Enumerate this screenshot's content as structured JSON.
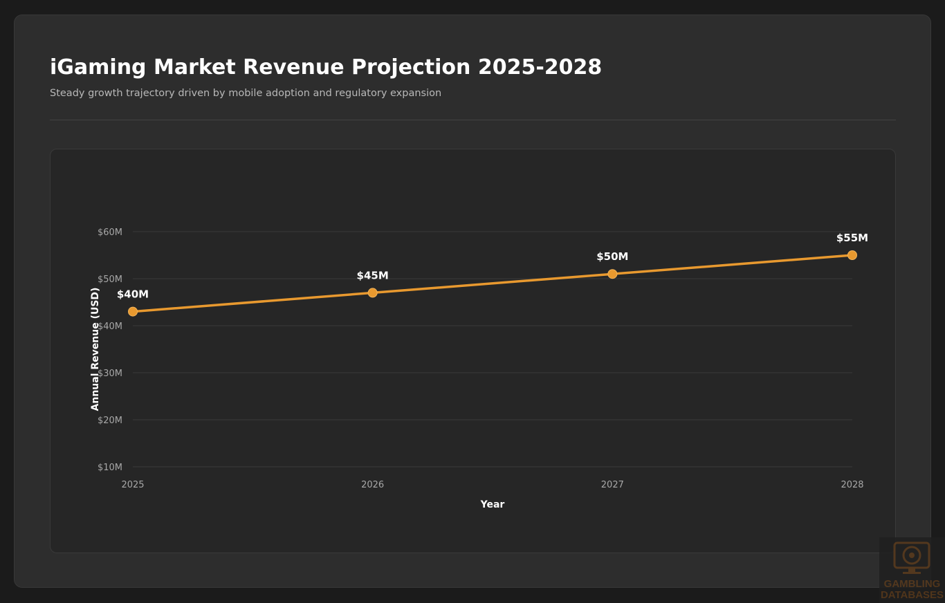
{
  "header": {
    "title": "iGaming Market Revenue Projection 2025-2028",
    "subtitle": "Steady growth trajectory driven by mobile adoption and regulatory expansion"
  },
  "colors": {
    "line": "#e8992f",
    "grid": "#3a3a3a",
    "tick_text": "#a8a8a8",
    "label_text": "#ffffff"
  },
  "chart_data": {
    "type": "line",
    "title": "",
    "xlabel": "Year",
    "ylabel": "Annual Revenue (USD)",
    "categories": [
      "2025",
      "2026",
      "2027",
      "2028"
    ],
    "values": [
      43,
      47,
      51,
      55
    ],
    "data_labels": [
      "$40M",
      "$45M",
      "$50M",
      "$55M"
    ],
    "yticks": [
      10,
      20,
      30,
      40,
      50,
      60
    ],
    "ytick_labels": [
      "$10M",
      "$20M",
      "$30M",
      "$40M",
      "$50M",
      "$60M"
    ],
    "ylim": [
      10,
      60
    ],
    "grid": true,
    "legend": "none"
  },
  "watermark": {
    "line1": "GAMBLING",
    "line2": "DATABASES",
    "icon": "casino-monitor-icon"
  }
}
